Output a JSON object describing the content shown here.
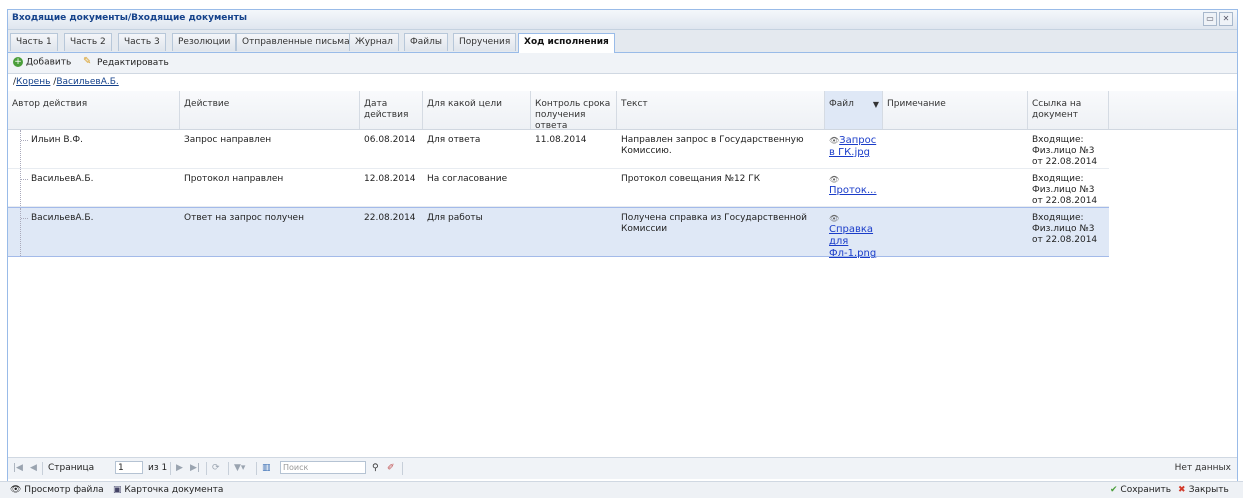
{
  "window": {
    "title": "Входящие документы/Входящие документы"
  },
  "tabs": [
    {
      "label": "Часть 1"
    },
    {
      "label": "Часть 2"
    },
    {
      "label": "Часть 3"
    },
    {
      "label": "Резолюции"
    },
    {
      "label": "Отправленные письма"
    },
    {
      "label": "Журнал"
    },
    {
      "label": "Файлы"
    },
    {
      "label": "Поручения"
    },
    {
      "label": "Ход исполнения"
    }
  ],
  "active_tab": "Ход исполнения",
  "toolbar": {
    "add_label": "Добавить",
    "edit_label": "Редактировать"
  },
  "breadcrumb": {
    "sep": "/",
    "root": "Корень",
    "current": "ВасильевА.Б."
  },
  "columns": {
    "author": "Автор действия",
    "action": "Действие",
    "date": "Дата действия",
    "purpose": "Для какой цели",
    "control": "Контроль срока получения ответа",
    "text": "Текст",
    "file": "Файл",
    "note": "Примечание",
    "link": "Ссылка на документ"
  },
  "rows": [
    {
      "author": "Ильин В.Ф.",
      "action": "Запрос направлен",
      "date": "06.08.2014",
      "purpose": "Для ответа",
      "control": "11.08.2014",
      "text": "Направлен запрос в Государственную Комиссию.",
      "file": "Запрос в ГК.jpg",
      "note": "",
      "link": "Входящие: Физ.лицо №3 от 22.08.2014"
    },
    {
      "author": "ВасильевА.Б.",
      "action": "Протокол направлен",
      "date": "12.08.2014",
      "purpose": "На согласование",
      "control": "",
      "text": "Протокол совещания №12 ГК",
      "file": "Проток...",
      "note": "",
      "link": "Входящие: Физ.лицо №3 от 22.08.2014"
    },
    {
      "author": "ВасильевА.Б.",
      "action": "Ответ на запрос получен",
      "date": "22.08.2014",
      "purpose": "Для работы",
      "control": "",
      "text": "Получена справка из Государственной Комиссии",
      "file": "Справка для Фл-1.png",
      "note": "",
      "link": "Входящие: Физ.лицо №3 от 22.08.2014"
    }
  ],
  "pager": {
    "page_label": "Страница",
    "page_value": "1",
    "of_label": "из 1",
    "search_placeholder": "Поиск",
    "status": "Нет данных"
  },
  "bottom": {
    "view_file": "Просмотр файла",
    "doc_card": "Карточка документа",
    "save": "Сохранить",
    "close": "Закрыть"
  },
  "colors": {
    "accent": "#15428b",
    "selected_row": "#dfe8f6",
    "link": "#1a3cc9"
  }
}
